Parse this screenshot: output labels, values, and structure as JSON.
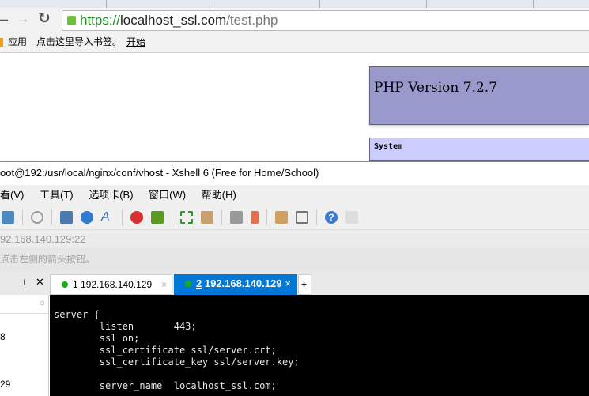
{
  "browser": {
    "url_scheme": "https://",
    "url_host": "localhost_ssl.com",
    "url_path": "/test.php",
    "bookmarks": [
      "应用",
      "点击这里导入书签。",
      "开始"
    ]
  },
  "page": {
    "php_version": "PHP Version 7.2.7",
    "section": "System"
  },
  "xshell": {
    "title": "oot@192:/usr/local/nginx/conf/vhost - Xshell 6 (Free for Home/School)",
    "menu": [
      "看(V)",
      "工具(T)",
      "选项卡(B)",
      "窗口(W)",
      "帮助(H)"
    ],
    "address": "92.168.140.129:22",
    "hint": "点击左侧的箭头按钮。",
    "tabs": [
      {
        "num": "1",
        "label": "192.168.140.129",
        "active": false
      },
      {
        "num": "2",
        "label": "192.168.140.129",
        "active": true
      }
    ],
    "left_items": [
      "8",
      "29"
    ],
    "terminal": "server {\n        listen       443;\n        ssl on;\n        ssl_certificate ssl/server.crt;\n        ssl_certificate_key ssl/server.key;\n\n        server_name  localhost_ssl.com;",
    "colors": {
      "active_tab": "#0078d7",
      "php_header": "#9999cc",
      "php_section": "#ccccff"
    }
  }
}
